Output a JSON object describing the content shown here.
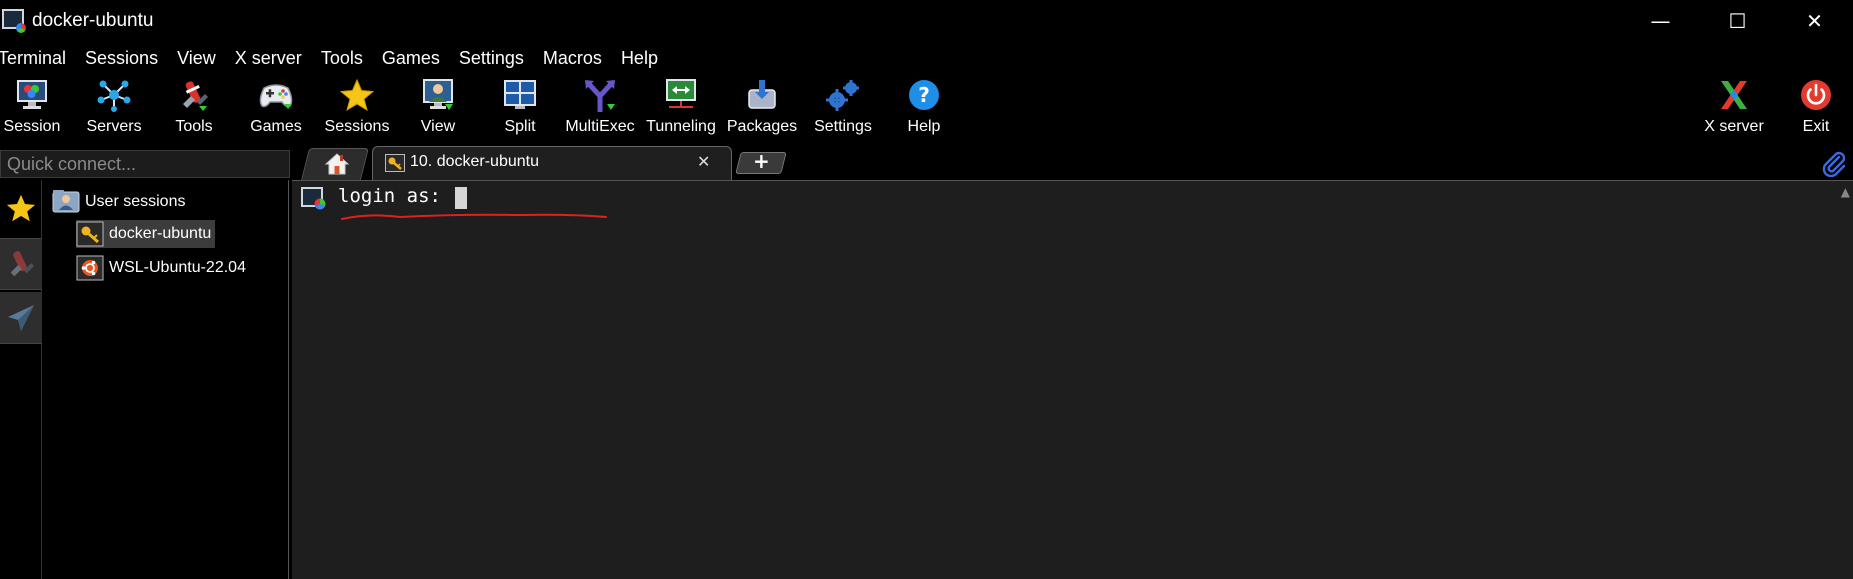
{
  "window": {
    "title": "docker-ubuntu",
    "minimize": "—",
    "maximize": "☐",
    "close": "✕"
  },
  "menu": [
    "Terminal",
    "Sessions",
    "View",
    "X server",
    "Tools",
    "Games",
    "Settings",
    "Macros",
    "Help"
  ],
  "toolbar": {
    "session": "Session",
    "servers": "Servers",
    "tools": "Tools",
    "games": "Games",
    "sessions": "Sessions",
    "view": "View",
    "split": "Split",
    "multiexec": "MultiExec",
    "tunneling": "Tunneling",
    "packages": "Packages",
    "settings": "Settings",
    "help": "Help",
    "xserver": "X server",
    "exit": "Exit"
  },
  "quick_connect": {
    "placeholder": "Quick connect..."
  },
  "tabs": {
    "active": "10. docker-ubuntu",
    "close": "✕",
    "add": "+"
  },
  "sidebar": {
    "group": "User sessions",
    "items": [
      "docker-ubuntu",
      "WSL-Ubuntu-22.04"
    ]
  },
  "terminal": {
    "prompt": "login as: "
  },
  "colors": {
    "annotation": "#e0201e",
    "help_blue": "#1e8fe8",
    "exit_red": "#e23b2e",
    "star_yellow": "#f5c518"
  }
}
